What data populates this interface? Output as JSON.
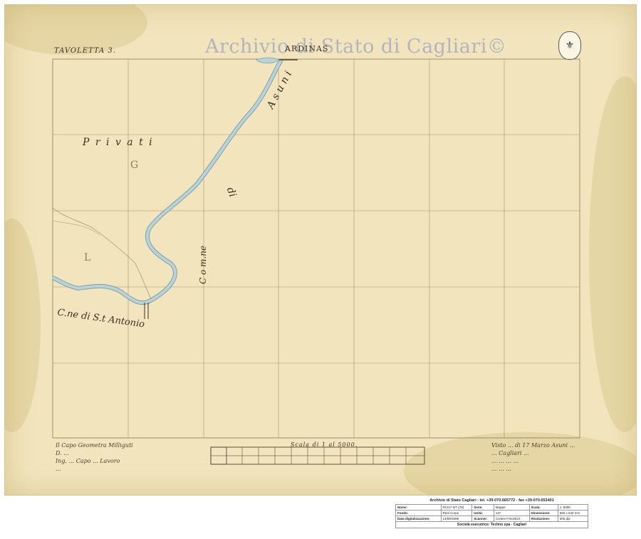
{
  "map": {
    "tavoletta": "TAVOLETTA 3.",
    "watermark": "Archivio di Stato di Cagliari©",
    "place_top": "ARDINAS",
    "labels": {
      "privati": "P r i v a t i",
      "g": "G",
      "di": "di",
      "asuni": "A s u n i",
      "com": "C o m.ne",
      "l": "L",
      "antonio": "C.ne di S.t Antonio"
    },
    "scale_title": "Scala di 1 al 5000.",
    "signature_left": [
      "Il Capo Geometra Milliguti",
      "D. ...",
      "Ing. ... Capo ... Lavoro",
      "..."
    ],
    "signature_right": [
      "Visto ... di 17 Marzo Asuni ...",
      "... Cagliari ... ",
      "... ... ... ...",
      "... ... ..."
    ],
    "seal_icon": "coat-of-arms-icon"
  },
  "info": {
    "header": "Archivio di Stato Cagliari - tel. +39-070.665772 - fax +39-070.653401",
    "rows": [
      [
        {
          "k": "Nome:"
        },
        {
          "v": "RC/17-0/7 (78)"
        },
        {
          "k": "Serie:"
        },
        {
          "v": "Mappe"
        },
        {
          "k": "Scala:"
        },
        {
          "v": "1: 5000"
        }
      ],
      [
        {
          "k": "Fondo:"
        },
        {
          "v": "Real Corpo"
        },
        {
          "k": "Unità:"
        },
        {
          "v": "137"
        },
        {
          "k": "Dimensione:"
        },
        {
          "v": "665 x 540 mm"
        }
      ],
      [
        {
          "k": "Data digitalizzazione:"
        },
        {
          "v": "14/09/1999"
        },
        {
          "k": "Scanner:"
        },
        {
          "v": "Contex FSC8010"
        },
        {
          "k": "Risoluzione:"
        },
        {
          "v": "300 dpi"
        }
      ]
    ],
    "footer": "Società esecutrice: Techno spa - Cagliari"
  },
  "colors": {
    "paper": "#f2e5bd",
    "ink": "#3a2f22",
    "river": "#a8c7cf",
    "grid": "#8a7a5a"
  }
}
